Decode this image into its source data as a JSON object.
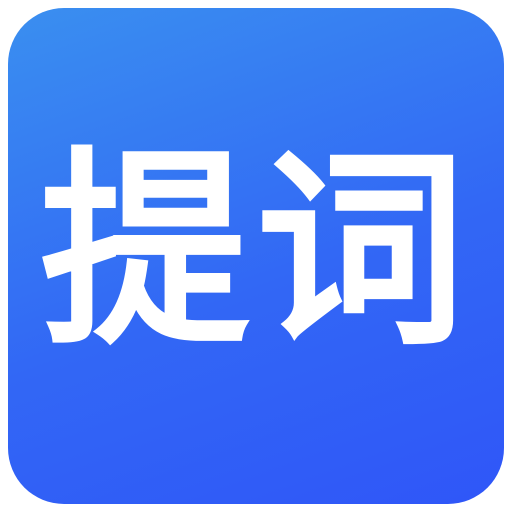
{
  "app_icon": {
    "label": "提词",
    "gradient_start": "#3a8ff0",
    "gradient_end": "#2f56f8",
    "text_color": "#ffffff"
  }
}
